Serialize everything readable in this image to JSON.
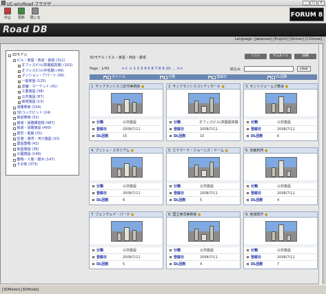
{
  "window": {
    "title": "UC-win/Road ブラウザ"
  },
  "toolbar": {
    "back_label": "中止",
    "refresh_label": "更新",
    "close_label": "閉じる"
  },
  "banner": {
    "logo_text": "Road DB",
    "forum_logo": "FORUM 8"
  },
  "langbar": {
    "text": "Language: [Japanese] [English] [Korean] [Chinese]"
  },
  "tree": {
    "items": [
      {
        "label": "3Dモデル",
        "indent": 0,
        "link": false
      },
      {
        "label": "ビル・家屋・商店・鉄塔 (311)",
        "indent": 1,
        "link": true
      },
      {
        "label": "オフィスビル(高層超高層) (102)",
        "indent": 2,
        "link": true
      },
      {
        "label": "オフィスビル(中低層) (49)",
        "indent": 2,
        "link": true
      },
      {
        "label": "マンション・アパート (56)",
        "indent": 2,
        "link": true
      },
      {
        "label": "一般家屋 (125)",
        "indent": 2,
        "link": true
      },
      {
        "label": "店舗・マーケット (41)",
        "indent": 2,
        "link": true
      },
      {
        "label": "工業施設 (38)",
        "indent": 2,
        "link": true
      },
      {
        "label": "公共施設 (87)",
        "indent": 2,
        "link": true
      },
      {
        "label": "鉄塔施設 (13)",
        "indent": 2,
        "link": true
      },
      {
        "label": "道路車両 (154)",
        "indent": 1,
        "link": true
      },
      {
        "label": "3Dコックピット (24)",
        "indent": 1,
        "link": true
      },
      {
        "label": "鉄道車両 (31)",
        "indent": 1,
        "link": true
      },
      {
        "label": "鉄道・道路構造物 (487)",
        "indent": 1,
        "link": true
      },
      {
        "label": "鉄道・道路施設 (400)",
        "indent": 1,
        "link": true
      },
      {
        "label": "航空・船舶 (31)",
        "indent": 1,
        "link": true
      },
      {
        "label": "空港・港湾・河川施設 (33)",
        "indent": 1,
        "link": true
      },
      {
        "label": "建設重機 (42)",
        "indent": 1,
        "link": true
      },
      {
        "label": "仮設施設 (36)",
        "indent": 1,
        "link": true
      },
      {
        "label": "公園施設 (149)",
        "indent": 1,
        "link": true
      },
      {
        "label": "動物・人間・樹木 (147)",
        "indent": 1,
        "link": true
      },
      {
        "label": "その他 (373)",
        "indent": 1,
        "link": true
      }
    ]
  },
  "content": {
    "breadcrumb": "3Dモデル / ビル・家屋・商店・鉄塔",
    "header_buttons": [
      "リスト",
      "サムネイル",
      "詳細"
    ],
    "page_label": "Page : 1/43",
    "pager": "<< < 1 2 3 4 5 6 7 8 9 10 ... >>",
    "filter_label": "絞込み",
    "filter_value": "",
    "clear_label": "clear",
    "sort": [
      "タイトル",
      "分類",
      "登録日",
      "DL回数"
    ],
    "meta_keys": {
      "category": "分類",
      "date": "登録日",
      "downloads": "DL回数"
    },
    "cards": [
      {
        "title": "1. サンフランシスコ近代美術館",
        "category": "公共施設",
        "date": "2008/7/11",
        "downloads": "15"
      },
      {
        "title": "2. サンフランシスコシティホール",
        "category": "オフィスビル(高層超高層)",
        "date": "2008/7/11",
        "downloads": "10"
      },
      {
        "title": "3. セントジェームズ教会",
        "category": "公共施設",
        "date": "2008/7/11",
        "downloads": "6"
      },
      {
        "title": "4. ブッシュ・スタジアム",
        "category": "公共施設",
        "date": "2008/7/11",
        "downloads": "8"
      },
      {
        "title": "5. エドワード・ジョーンズ・ドーム",
        "category": "公共施設",
        "date": "2008/7/11",
        "downloads": "5"
      },
      {
        "title": "6. 旧裁判所",
        "category": "公共施設",
        "date": "2008/7/11",
        "downloads": "4"
      },
      {
        "title": "7. フェンウェイ・パーク",
        "category": "公共施設",
        "date": "2008/7/11",
        "downloads": "5"
      },
      {
        "title": "8. 国立西洋美術館",
        "category": "公共施設",
        "date": "2008/7/11",
        "downloads": "4"
      },
      {
        "title": "9. 宮城県庁",
        "category": "公共施設",
        "date": "2008/7/11",
        "downloads": "7"
      }
    ]
  },
  "status": {
    "text": "[3DModel] [3DModel]"
  },
  "colors": {
    "banner": "#1a1a1a",
    "card_header": "#d6e0ef",
    "sort_bar": "#6a86b3",
    "link": "#1b2fa4"
  }
}
